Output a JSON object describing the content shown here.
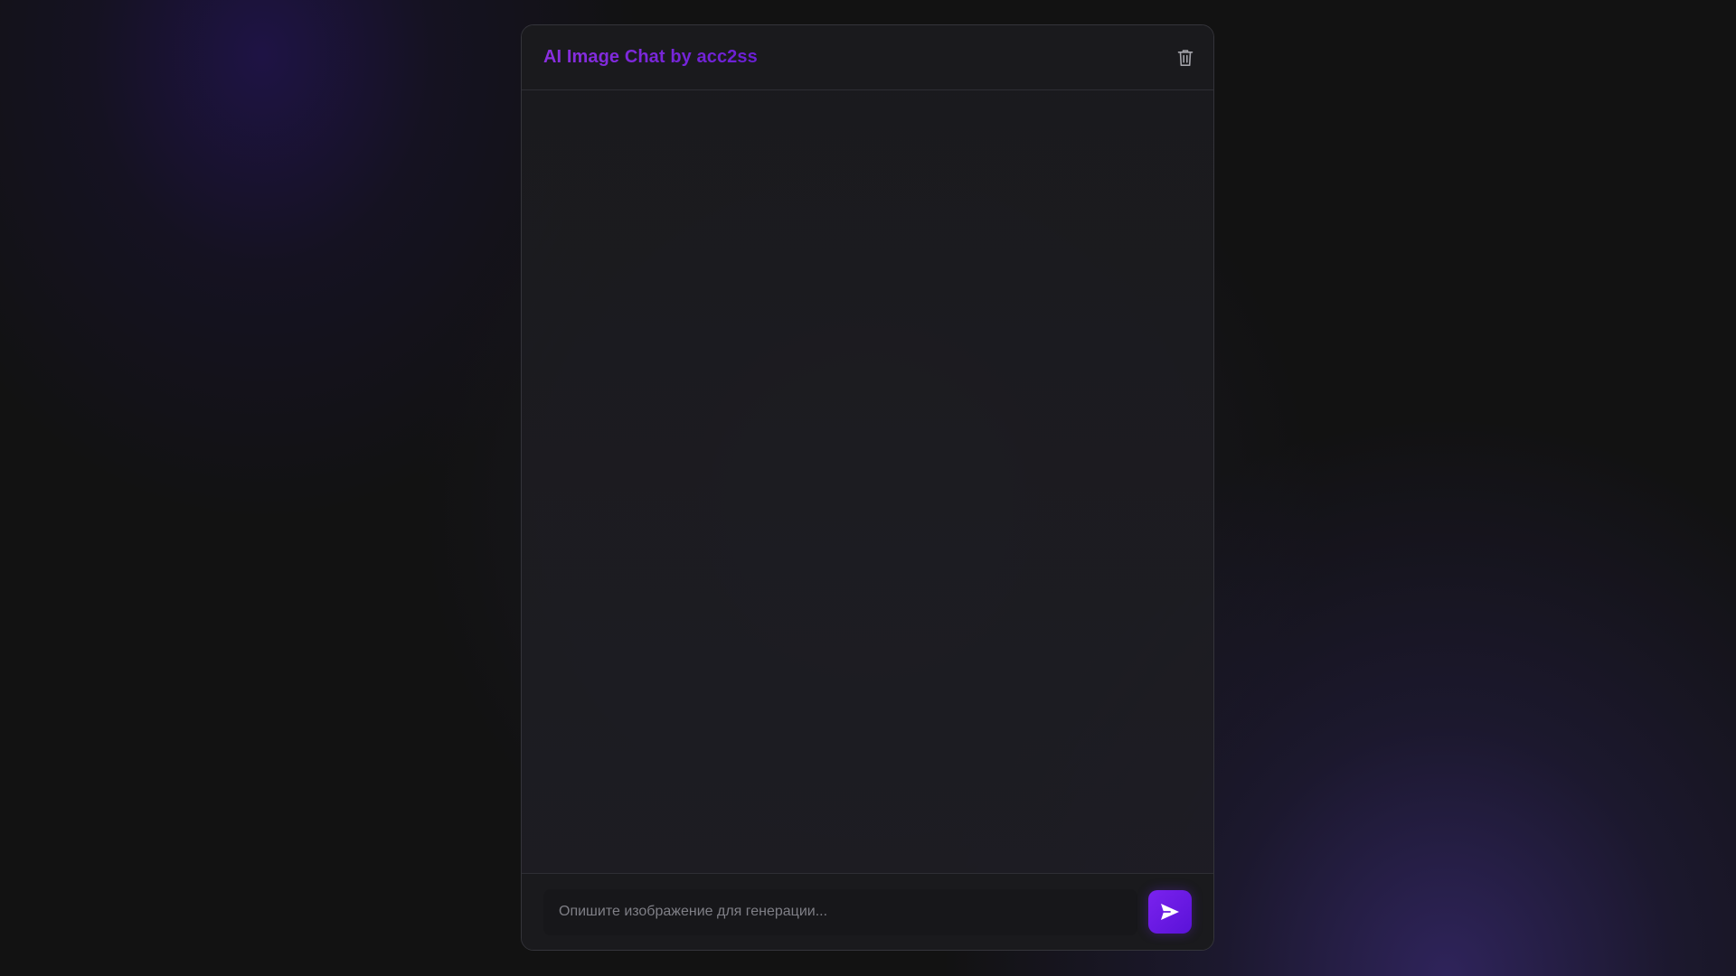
{
  "app": {
    "title": "AI Image Chat by acc2ss",
    "accent_colors": [
      "#8b2fe0",
      "#6a1fd4"
    ]
  },
  "header": {
    "clear_icon": "trash-icon"
  },
  "messages": [],
  "composer": {
    "input_value": "",
    "input_placeholder": "Опишите изображение для генерации...",
    "send_icon": "send-icon",
    "send_button_color": "#6a1be0"
  }
}
